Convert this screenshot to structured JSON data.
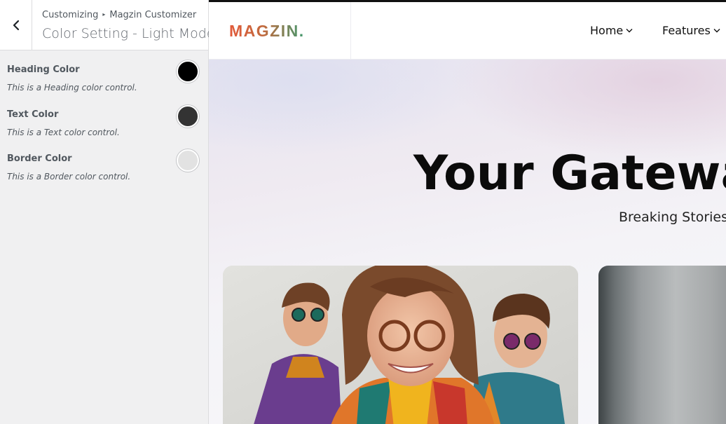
{
  "customizer": {
    "breadcrumb": {
      "parent": "Customizing",
      "separator": "▸",
      "child": "Magzin Customizer"
    },
    "section_title": "Color Setting - Light Mode",
    "controls": [
      {
        "label": "Heading Color",
        "description": "This is a Heading color control.",
        "color": "#000000"
      },
      {
        "label": "Text Color",
        "description": "This is a Text color control.",
        "color": "#333333"
      },
      {
        "label": "Border Color",
        "description": "This is a Border color control.",
        "color": "#e2e2e2"
      }
    ]
  },
  "site": {
    "logo": "MAGZIN.",
    "nav": [
      {
        "label": "Home"
      },
      {
        "label": "Features"
      }
    ],
    "hero": {
      "title": "Your Gatewa",
      "subtitle": "Breaking Stories"
    }
  }
}
